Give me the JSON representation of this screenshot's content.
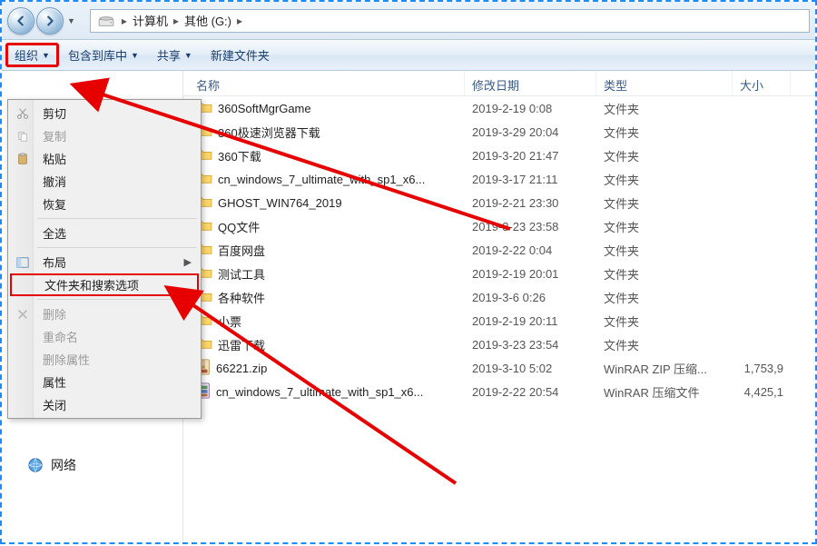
{
  "nav": {
    "path_parts": [
      "计算机",
      "其他 (G:)"
    ]
  },
  "toolbar": {
    "organize": "组织",
    "include_lib": "包含到库中",
    "share": "共享",
    "new_folder": "新建文件夹"
  },
  "columns": {
    "name": "名称",
    "date": "修改日期",
    "type": "类型",
    "size": "大小"
  },
  "menu": {
    "cut": "剪切",
    "copy": "复制",
    "paste": "粘贴",
    "undo": "撤消",
    "redo": "恢复",
    "select_all": "全选",
    "layout": "布局",
    "folder_search_options": "文件夹和搜索选项",
    "delete": "删除",
    "rename": "重命名",
    "remove_props": "删除属性",
    "properties": "属性",
    "close": "关闭"
  },
  "sidebar": {
    "network": "网络"
  },
  "files": [
    {
      "icon": "folder",
      "name": "360SoftMgrGame",
      "date": "2019-2-19 0:08",
      "type": "文件夹",
      "size": ""
    },
    {
      "icon": "folder",
      "name": "360极速浏览器下载",
      "date": "2019-3-29 20:04",
      "type": "文件夹",
      "size": ""
    },
    {
      "icon": "folder",
      "name": "360下载",
      "date": "2019-3-20 21:47",
      "type": "文件夹",
      "size": ""
    },
    {
      "icon": "folder",
      "name": "cn_windows_7_ultimate_with_sp1_x6...",
      "date": "2019-3-17 21:11",
      "type": "文件夹",
      "size": ""
    },
    {
      "icon": "folder",
      "name": "GHOST_WIN764_2019",
      "date": "2019-2-21 23:30",
      "type": "文件夹",
      "size": ""
    },
    {
      "icon": "folder",
      "name": "QQ文件",
      "date": "2019-3-23 23:58",
      "type": "文件夹",
      "size": ""
    },
    {
      "icon": "folder",
      "name": "百度网盘",
      "date": "2019-2-22 0:04",
      "type": "文件夹",
      "size": ""
    },
    {
      "icon": "folder",
      "name": "测试工具",
      "date": "2019-2-19 20:01",
      "type": "文件夹",
      "size": ""
    },
    {
      "icon": "folder",
      "name": "各种软件",
      "date": "2019-3-6 0:26",
      "type": "文件夹",
      "size": ""
    },
    {
      "icon": "folder",
      "name": "小票",
      "date": "2019-2-19 20:11",
      "type": "文件夹",
      "size": ""
    },
    {
      "icon": "folder",
      "name": "迅雷下载",
      "date": "2019-3-23 23:54",
      "type": "文件夹",
      "size": ""
    },
    {
      "icon": "zip",
      "name": "66221.zip",
      "date": "2019-3-10 5:02",
      "type": "WinRAR ZIP 压缩...",
      "size": "1,753,9"
    },
    {
      "icon": "rar",
      "name": "cn_windows_7_ultimate_with_sp1_x6...",
      "date": "2019-2-22 20:54",
      "type": "WinRAR 压缩文件",
      "size": "4,425,1"
    }
  ]
}
